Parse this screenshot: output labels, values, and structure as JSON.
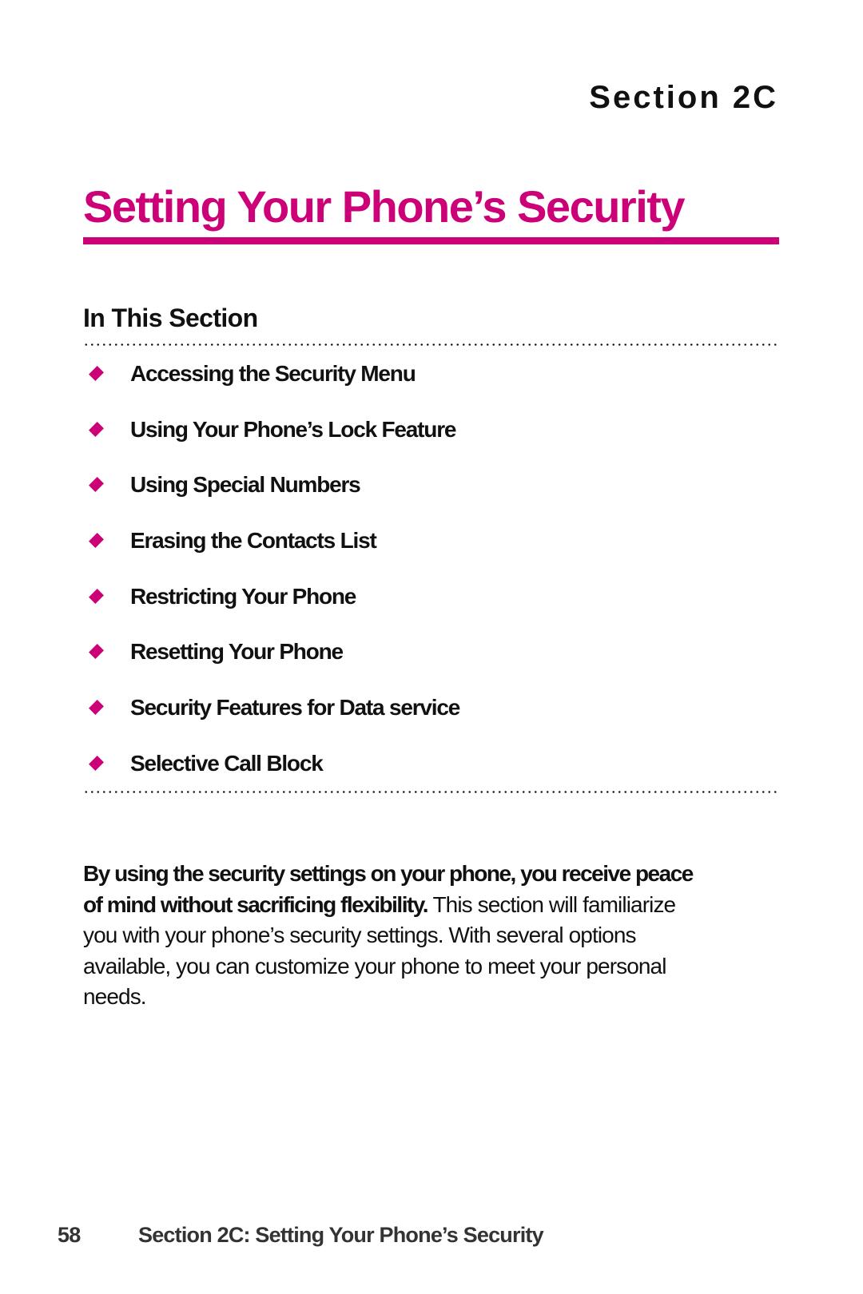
{
  "header": {
    "section_label": "Section 2C",
    "title": "Setting Your Phone’s Security"
  },
  "in_this_section": {
    "heading": "In This Section",
    "items": [
      {
        "label": "Accessing the Security Menu"
      },
      {
        "label": "Using Your Phone’s Lock Feature"
      },
      {
        "label": "Using Special Numbers"
      },
      {
        "label": "Erasing the Contacts List"
      },
      {
        "label": "Restricting Your Phone"
      },
      {
        "label": "Resetting Your Phone"
      },
      {
        "label": "Security Features for Data service"
      },
      {
        "label": "Selective Call Block"
      }
    ],
    "bullet_icon": "diamond-bullet"
  },
  "intro": {
    "bold": "By using the security settings on your phone, you receive peace of mind without sacrificing flexibility.",
    "body": " This section will familiarize you with your phone’s security settings. With several options available, you can customize your phone to meet your personal needs."
  },
  "footer": {
    "page_number": "58",
    "running_title": "Section 2C: Setting Your Phone’s Security"
  },
  "colors": {
    "accent": "#cc0077",
    "text": "#111111",
    "footer_text": "#333333"
  }
}
